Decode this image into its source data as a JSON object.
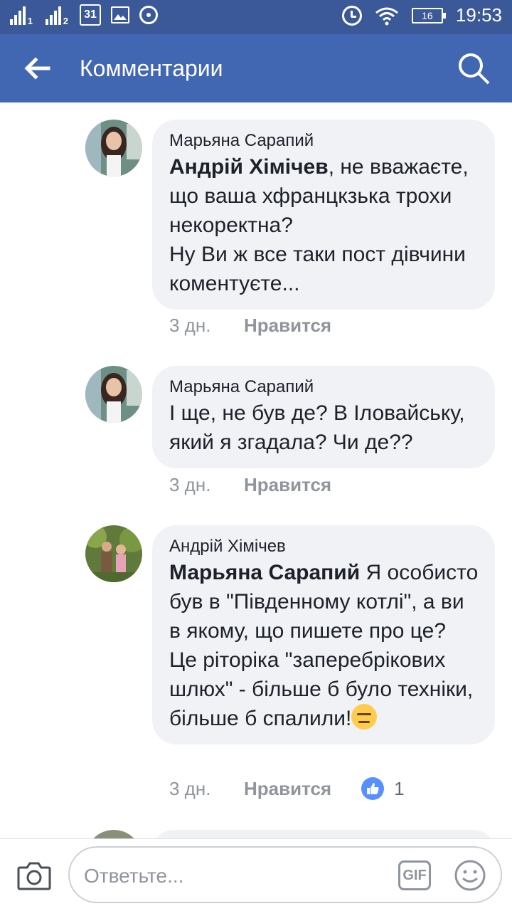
{
  "status_bar": {
    "sim1_label": "1",
    "sim2_label": "2",
    "calendar_day": "31",
    "battery": "16",
    "time": "19:53"
  },
  "app_bar": {
    "title": "Комментарии"
  },
  "comments": [
    {
      "author": "Марьяна Сарапий",
      "mention": "",
      "text": "",
      "lines": [
        "Андрій Хімічев",
        ", не вважаєте, що ваша хфранцкзька трохи некоректна?",
        "Ну Ви ж все таки пост дівчини коментуєте..."
      ],
      "time": "3 дн.",
      "like_label": "Нравится"
    },
    {
      "author": "Марьяна Сарапий",
      "text": "І ще, не був де? В Іловайську, який я згадала? Чи де??",
      "time": "3 дн.",
      "like_label": "Нравится"
    },
    {
      "author": "Андрій Хімічев",
      "mention": "Марьяна Сарапий",
      "text": " Я особисто був в \"Південному котлі\", а ви в якому, що пишете про це? Це рітоpіка \"заперебрікових шлюх\" - більше б було техніки, більше б спалили!",
      "time": "3 дн.",
      "like_label": "Нравится",
      "like_count": "1"
    }
  ],
  "composer": {
    "placeholder": "Ответьте...",
    "gif_label": "GIF"
  },
  "colors": {
    "status_bar": "#3b5998",
    "app_bar": "#4267b2",
    "bubble": "#f1f2f6",
    "like_badge": "#5890ff"
  }
}
